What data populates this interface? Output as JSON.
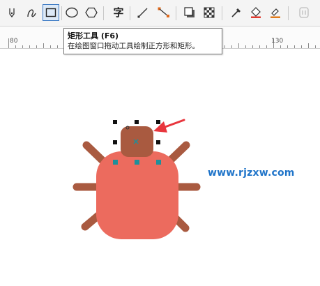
{
  "toolbar": {
    "tools": [
      {
        "name": "pen-tool-icon"
      },
      {
        "name": "freehand-tool-icon"
      },
      {
        "name": "rectangle-tool-icon",
        "active": true
      },
      {
        "name": "ellipse-tool-icon"
      },
      {
        "name": "polygon-tool-icon"
      },
      {
        "name": "text-tool-icon",
        "glyph": "字"
      },
      {
        "name": "line-tool-icon"
      },
      {
        "name": "connector-tool-icon"
      },
      {
        "name": "drop-shadow-tool-icon"
      },
      {
        "name": "transparency-tool-icon"
      },
      {
        "name": "eyedropper-tool-icon"
      },
      {
        "name": "fill-tool-icon"
      },
      {
        "name": "smart-fill-tool-icon"
      },
      {
        "name": "disabled-tool-icon"
      }
    ],
    "active_color": "#3b79c4"
  },
  "ruler": {
    "labels": [
      "80",
      "130"
    ]
  },
  "tooltip": {
    "title": "矩形工具 (F6)",
    "description": "在绘图窗口拖动工具绘制正方形和矩形。"
  },
  "canvas": {
    "watermark": "www.rjzxw.com",
    "colors": {
      "body": "#ec6b5e",
      "head_and_legs": "#a95a40",
      "node_markers": "#1f8f9a",
      "arrow": "#e8363d",
      "selection_handles": "#111111",
      "watermark": "#1f74c9"
    }
  }
}
